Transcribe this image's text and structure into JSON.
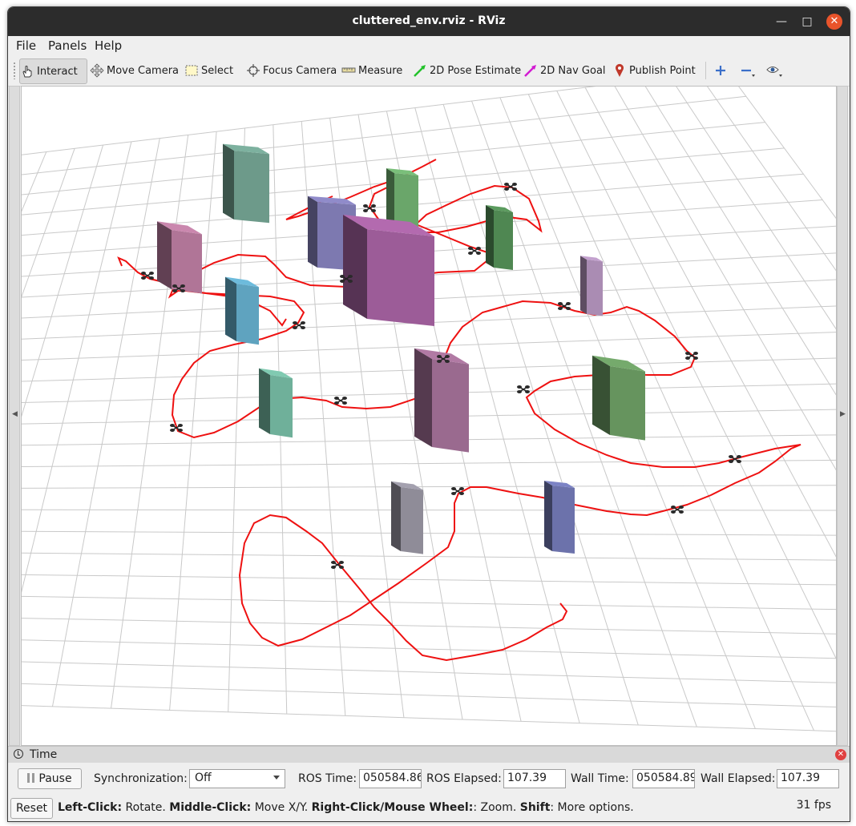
{
  "window": {
    "title": "cluttered_env.rviz - RViz"
  },
  "menu": {
    "file": "File",
    "panels": "Panels",
    "help": "Help"
  },
  "toolbar": {
    "interact": "Interact",
    "move_camera": "Move Camera",
    "select": "Select",
    "focus_camera": "Focus Camera",
    "measure": "Measure",
    "pose_estimate": "2D Pose Estimate",
    "nav_goal": "2D Nav Goal",
    "publish_point": "Publish Point"
  },
  "colors": {
    "pose_estimate": "#22c22a",
    "nav_goal": "#d21bd2",
    "publish_point": "#c0392b",
    "trajectory": "#ee1111",
    "grid": "#c9c9c9"
  },
  "scene": {
    "obstacles": [
      {
        "name": "obstacle-teal-tall",
        "color": "#6d9a8a"
      },
      {
        "name": "obstacle-green-back",
        "color": "#6aa66a"
      },
      {
        "name": "obstacle-purple-block",
        "color": "#7d79b0"
      },
      {
        "name": "obstacle-magenta-cube",
        "color": "#9c5c98"
      },
      {
        "name": "obstacle-mauve-left",
        "color": "#b07597"
      },
      {
        "name": "obstacle-dark-green",
        "color": "#4f8752"
      },
      {
        "name": "obstacle-cyan",
        "color": "#5fa3bf"
      },
      {
        "name": "obstacle-lavender",
        "color": "#aa8cb3"
      },
      {
        "name": "obstacle-mint",
        "color": "#6fb09a"
      },
      {
        "name": "obstacle-plum-slab",
        "color": "#9a6a8f"
      },
      {
        "name": "obstacle-green-right",
        "color": "#66945e"
      },
      {
        "name": "obstacle-grey",
        "color": "#8f8c98"
      },
      {
        "name": "obstacle-blue",
        "color": "#6c72ab"
      }
    ],
    "drone_count": 17
  },
  "time_panel": {
    "title": "Time",
    "pause_label": "Pause",
    "sync_label": "Synchronization:",
    "sync_value": "Off",
    "ros_time_label": "ROS Time:",
    "ros_time_value": "050584.86",
    "ros_elapsed_label": "ROS Elapsed:",
    "ros_elapsed_value": "107.39",
    "wall_time_label": "Wall Time:",
    "wall_time_value": "050584.89",
    "wall_elapsed_label": "Wall Elapsed:",
    "wall_elapsed_value": "107.39"
  },
  "status": {
    "reset_label": "Reset",
    "k1": "Left-Click:",
    "v1": " Rotate. ",
    "k2": "Middle-Click:",
    "v2": " Move X/Y. ",
    "k3": "Right-Click/Mouse Wheel:",
    "v3": ": Zoom. ",
    "k4": "Shift",
    "v4": ": More options.",
    "fps": "31 fps"
  }
}
